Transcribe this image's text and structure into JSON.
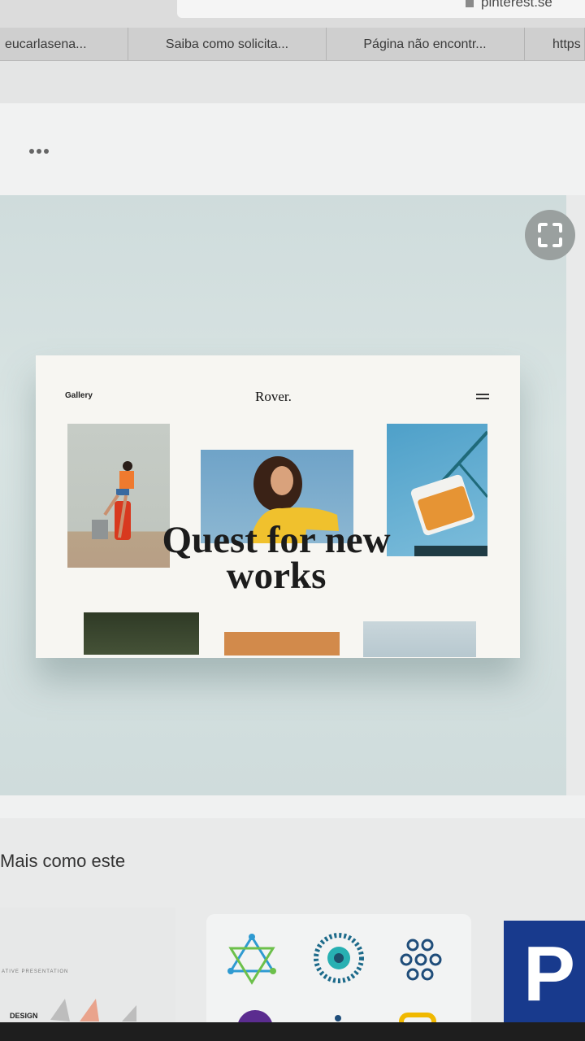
{
  "browser": {
    "url": "pinterest.se",
    "tabs": [
      {
        "label": "eucarlasena..."
      },
      {
        "label": "Saiba como solicita..."
      },
      {
        "label": "Página não encontr..."
      },
      {
        "label": "https"
      }
    ]
  },
  "pin_header": {
    "more_icon": "ellipsis-icon"
  },
  "pin_image": {
    "expand_icon": "expand-icon",
    "site": {
      "nav_left": "Gallery",
      "brand": "Rover.",
      "menu_icon": "hamburger-icon",
      "headline_line1": "Quest for new",
      "headline_line2": "works"
    }
  },
  "more_like_this": {
    "heading": "Mais como este",
    "thumb1_caption": "ATIVE PRESENTATION",
    "thumb1_label": "DESIGN",
    "thumb3_letter": "P"
  }
}
